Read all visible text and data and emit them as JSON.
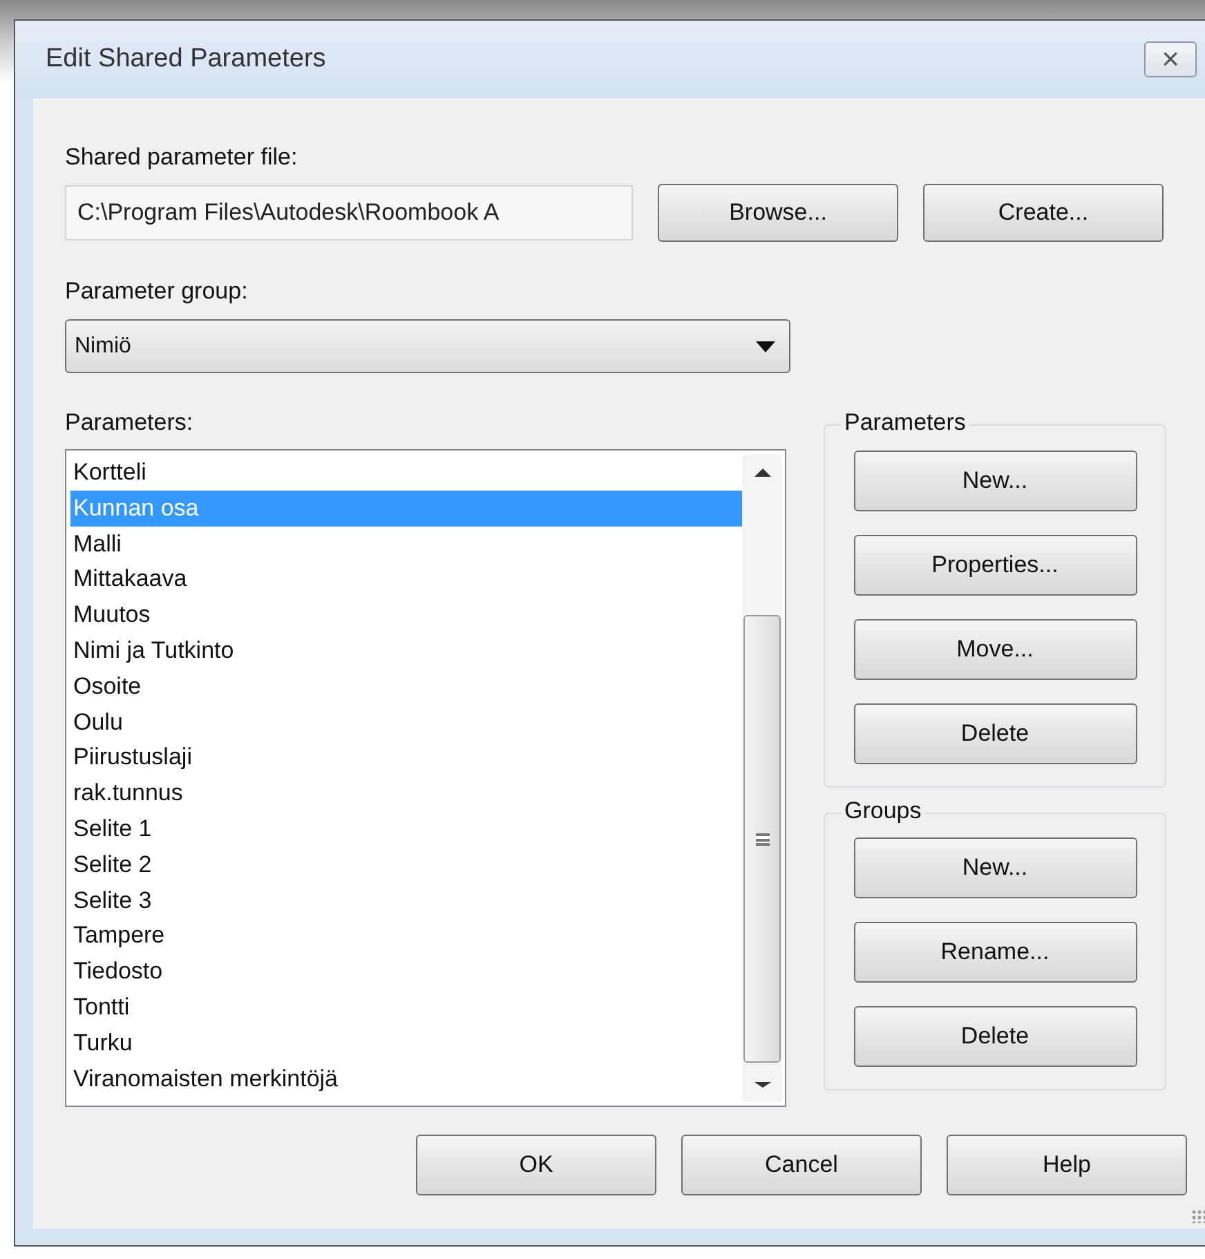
{
  "window": {
    "title": "Edit Shared Parameters",
    "close": "×"
  },
  "file_label": "Shared parameter file:",
  "file_field": {
    "value": "C:\\Program Files\\Autodesk\\Roombook A"
  },
  "file_buttons": [
    "Browse...",
    "Create..."
  ],
  "group_label": "Parameter group:",
  "group_dropdown": {
    "value": "Nimiö"
  },
  "parameters_label": "Parameters:",
  "parameters": [
    {
      "label": "Kortteli",
      "selected": false
    },
    {
      "label": "Kunnan osa",
      "selected": true
    },
    {
      "label": "Malli",
      "selected": false
    },
    {
      "label": "Mittakaava",
      "selected": false
    },
    {
      "label": "Muutos",
      "selected": false
    },
    {
      "label": "Nimi ja Tutkinto",
      "selected": false
    },
    {
      "label": "Osoite",
      "selected": false
    },
    {
      "label": "Oulu",
      "selected": false
    },
    {
      "label": "Piirustuslaji",
      "selected": false
    },
    {
      "label": "rak.tunnus",
      "selected": false
    },
    {
      "label": "Selite 1",
      "selected": false
    },
    {
      "label": "Selite 2",
      "selected": false
    },
    {
      "label": "Selite 3",
      "selected": false
    },
    {
      "label": "Tampere",
      "selected": false
    },
    {
      "label": "Tiedosto",
      "selected": false
    },
    {
      "label": "Tontti",
      "selected": false
    },
    {
      "label": "Turku",
      "selected": false
    },
    {
      "label": "Viranomaisten merkintöjä",
      "selected": false
    }
  ],
  "groupboxes": [
    {
      "title": "Parameters",
      "buttons": [
        "New...",
        "Properties...",
        "Move...",
        "Delete"
      ]
    },
    {
      "title": "Groups",
      "buttons": [
        "New...",
        "Rename...",
        "Delete"
      ]
    }
  ],
  "dialog_buttons": [
    "OK",
    "Cancel",
    "Help"
  ]
}
